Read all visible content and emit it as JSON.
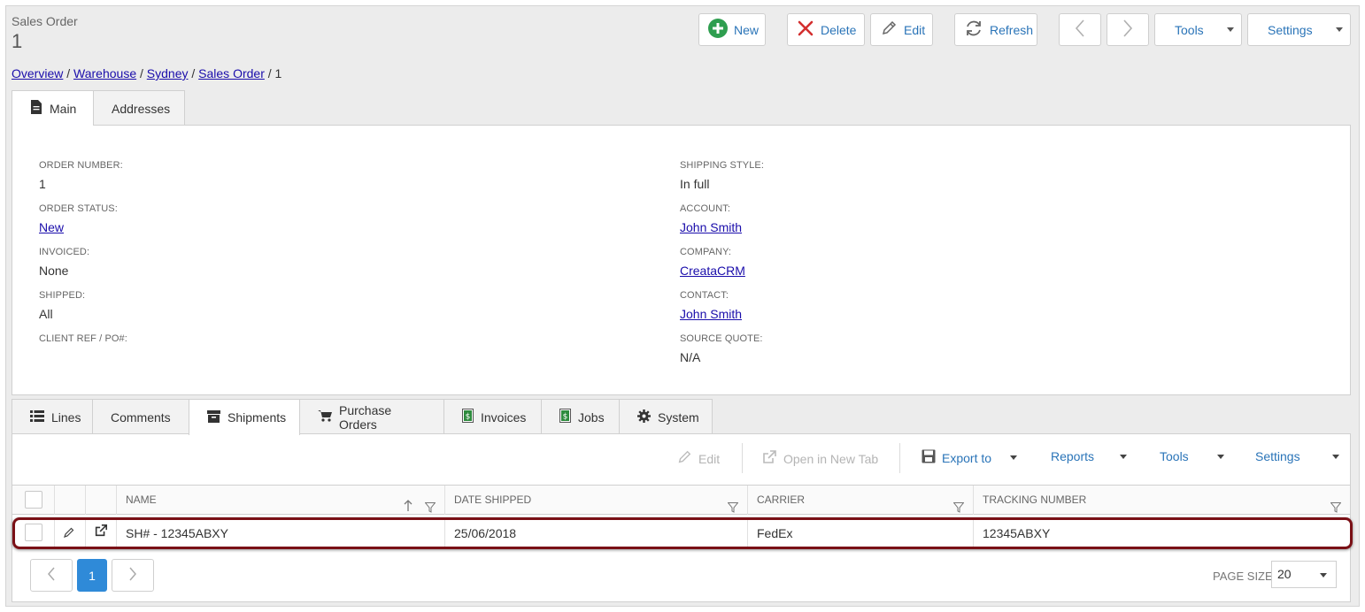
{
  "header": {
    "entity_label": "Sales Order",
    "entity_id": "1"
  },
  "toolbar": {
    "new_label": "New",
    "delete_label": "Delete",
    "edit_label": "Edit",
    "refresh_label": "Refresh",
    "tools_label": "Tools",
    "settings_label": "Settings"
  },
  "breadcrumb": {
    "items": [
      "Overview",
      "Warehouse",
      "Sydney",
      "Sales Order"
    ],
    "current": "1",
    "separator": "/"
  },
  "top_tabs": [
    {
      "label": "Main",
      "active": true
    },
    {
      "label": "Addresses",
      "active": false
    }
  ],
  "fields_left": [
    {
      "label": "ORDER NUMBER:",
      "value": "1",
      "link": false
    },
    {
      "label": "ORDER STATUS:",
      "value": "New",
      "link": true
    },
    {
      "label": "INVOICED:",
      "value": "None",
      "link": false
    },
    {
      "label": "SHIPPED:",
      "value": "All",
      "link": false
    },
    {
      "label": "CLIENT REF / PO#:",
      "value": "",
      "link": false
    }
  ],
  "fields_right": [
    {
      "label": "SHIPPING STYLE:",
      "value": "In full",
      "link": false
    },
    {
      "label": "ACCOUNT:",
      "value": "John Smith",
      "link": true
    },
    {
      "label": "COMPANY:",
      "value": "CreataCRM",
      "link": true
    },
    {
      "label": "CONTACT:",
      "value": "John Smith",
      "link": true
    },
    {
      "label": "SOURCE QUOTE:",
      "value": "N/A",
      "link": false
    }
  ],
  "bottom_tabs": [
    {
      "label": "Lines",
      "icon": "list-icon"
    },
    {
      "label": "Comments",
      "icon": ""
    },
    {
      "label": "Shipments",
      "icon": "box-icon",
      "active": true
    },
    {
      "label": "Purchase Orders",
      "icon": "cart-icon"
    },
    {
      "label": "Invoices",
      "icon": "dollar-doc-icon"
    },
    {
      "label": "Jobs",
      "icon": "dollar-doc-icon"
    },
    {
      "label": "System",
      "icon": "gear-icon"
    }
  ],
  "grid_toolbar": {
    "edit_label": "Edit",
    "open_new_tab_label": "Open in New Tab",
    "export_label": "Export to",
    "reports_label": "Reports",
    "tools_label": "Tools",
    "settings_label": "Settings"
  },
  "grid": {
    "columns": [
      "NAME",
      "DATE SHIPPED",
      "CARRIER",
      "TRACKING NUMBER"
    ],
    "rows": [
      {
        "name": "SH# - 12345ABXY",
        "date_shipped": "25/06/2018",
        "carrier": "FedEx",
        "tracking_number": "12345ABXY"
      }
    ]
  },
  "pager": {
    "current_page": "1",
    "page_size_label": "PAGE SIZE",
    "page_size": "20"
  },
  "colors": {
    "accent": "#2f8ad8",
    "link": "#1a0dab",
    "new_icon": "#2e9e4f",
    "delete_icon": "#d32f2f",
    "highlight": "#7a1016"
  }
}
